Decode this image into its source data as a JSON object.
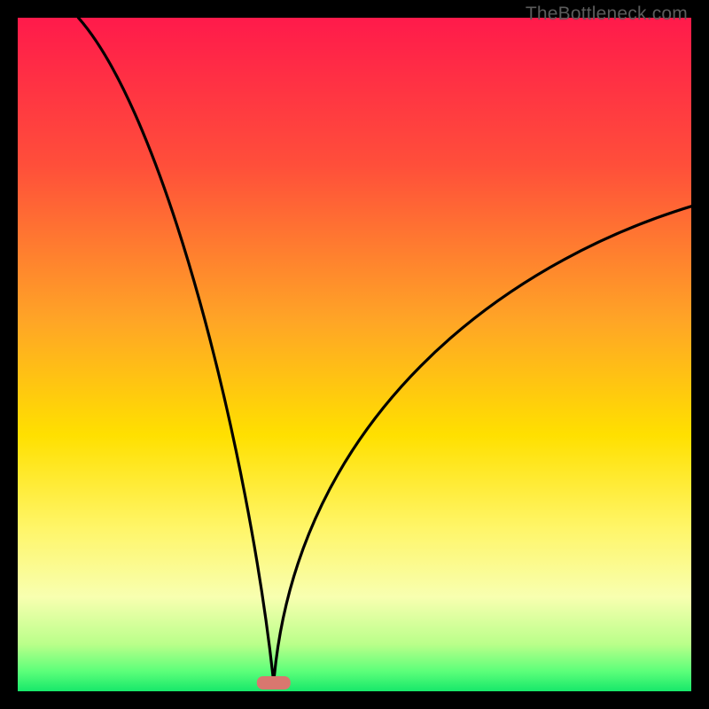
{
  "watermark": "TheBottleneck.com",
  "chart_data": {
    "type": "line",
    "title": "",
    "xlabel": "",
    "ylabel": "",
    "xlim": [
      0,
      100
    ],
    "ylim": [
      0,
      100
    ],
    "grid": false,
    "gradient_stops": [
      {
        "offset": 0,
        "color": "#ff1a4b"
      },
      {
        "offset": 22,
        "color": "#ff4f3a"
      },
      {
        "offset": 45,
        "color": "#ffa526"
      },
      {
        "offset": 62,
        "color": "#ffe000"
      },
      {
        "offset": 76,
        "color": "#fff66a"
      },
      {
        "offset": 86,
        "color": "#f8ffb0"
      },
      {
        "offset": 93,
        "color": "#baff8a"
      },
      {
        "offset": 97,
        "color": "#5dff7a"
      },
      {
        "offset": 100,
        "color": "#17e86a"
      }
    ],
    "curve": {
      "vertex_x": 38,
      "vertex_y": 0,
      "left_start": {
        "x": 9,
        "y": 100
      },
      "right_end": {
        "x": 100,
        "y": 72
      },
      "description": "V-shaped black curve descending steeply from upper-left, reaching a minimum near x≈38, then rising with a gentler slope toward the right edge",
      "series": [
        {
          "name": "bottleneck_curve",
          "x_y": [
            [
              9,
              100
            ],
            [
              12,
              89
            ],
            [
              15,
              78
            ],
            [
              18,
              67
            ],
            [
              21,
              56
            ],
            [
              24,
              45
            ],
            [
              27,
              35
            ],
            [
              30,
              25
            ],
            [
              33,
              14
            ],
            [
              35,
              7
            ],
            [
              37,
              2
            ],
            [
              38,
              0
            ],
            [
              39,
              1
            ],
            [
              41,
              4
            ],
            [
              44,
              10
            ],
            [
              48,
              18
            ],
            [
              53,
              26
            ],
            [
              58,
              34
            ],
            [
              64,
              42
            ],
            [
              70,
              49
            ],
            [
              76,
              55
            ],
            [
              82,
              60
            ],
            [
              88,
              65
            ],
            [
              94,
              69
            ],
            [
              100,
              72
            ]
          ]
        }
      ]
    },
    "marker": {
      "shape": "rounded_bar",
      "x": 38,
      "y": 0,
      "width_pct": 5,
      "color": "#d9776f"
    }
  }
}
